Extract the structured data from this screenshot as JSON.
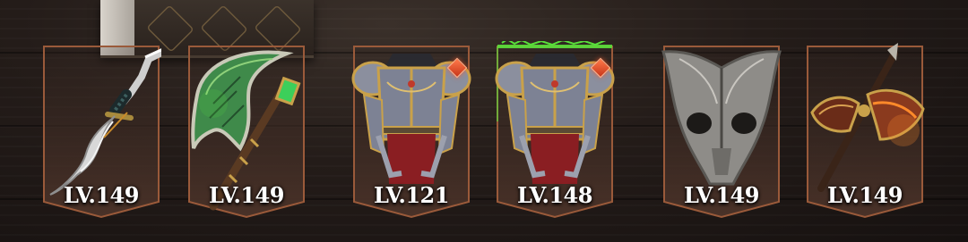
{
  "equipment": {
    "slots": [
      {
        "name": "curved-blade",
        "level_label": "LV.149",
        "has_badge": false,
        "glow": "none"
      },
      {
        "name": "jade-axe",
        "level_label": "LV.149",
        "has_badge": false,
        "glow": "green"
      },
      {
        "name": "plate-armor",
        "level_label": "LV.121",
        "has_badge": true,
        "glow": "none"
      },
      {
        "name": "plate-armor",
        "level_label": "LV.148",
        "has_badge": true,
        "glow": "green"
      },
      {
        "name": "skull-helmet",
        "level_label": "LV.149",
        "has_badge": false,
        "glow": "none"
      },
      {
        "name": "battle-axe",
        "level_label": "LV.149",
        "has_badge": false,
        "glow": "orange"
      }
    ]
  },
  "colors": {
    "banner_border": "#9a5a3a",
    "badge": "#d8472a",
    "glow_green": "#59e03a",
    "glow_orange": "#ff8a2a",
    "text": "#ffffff"
  }
}
